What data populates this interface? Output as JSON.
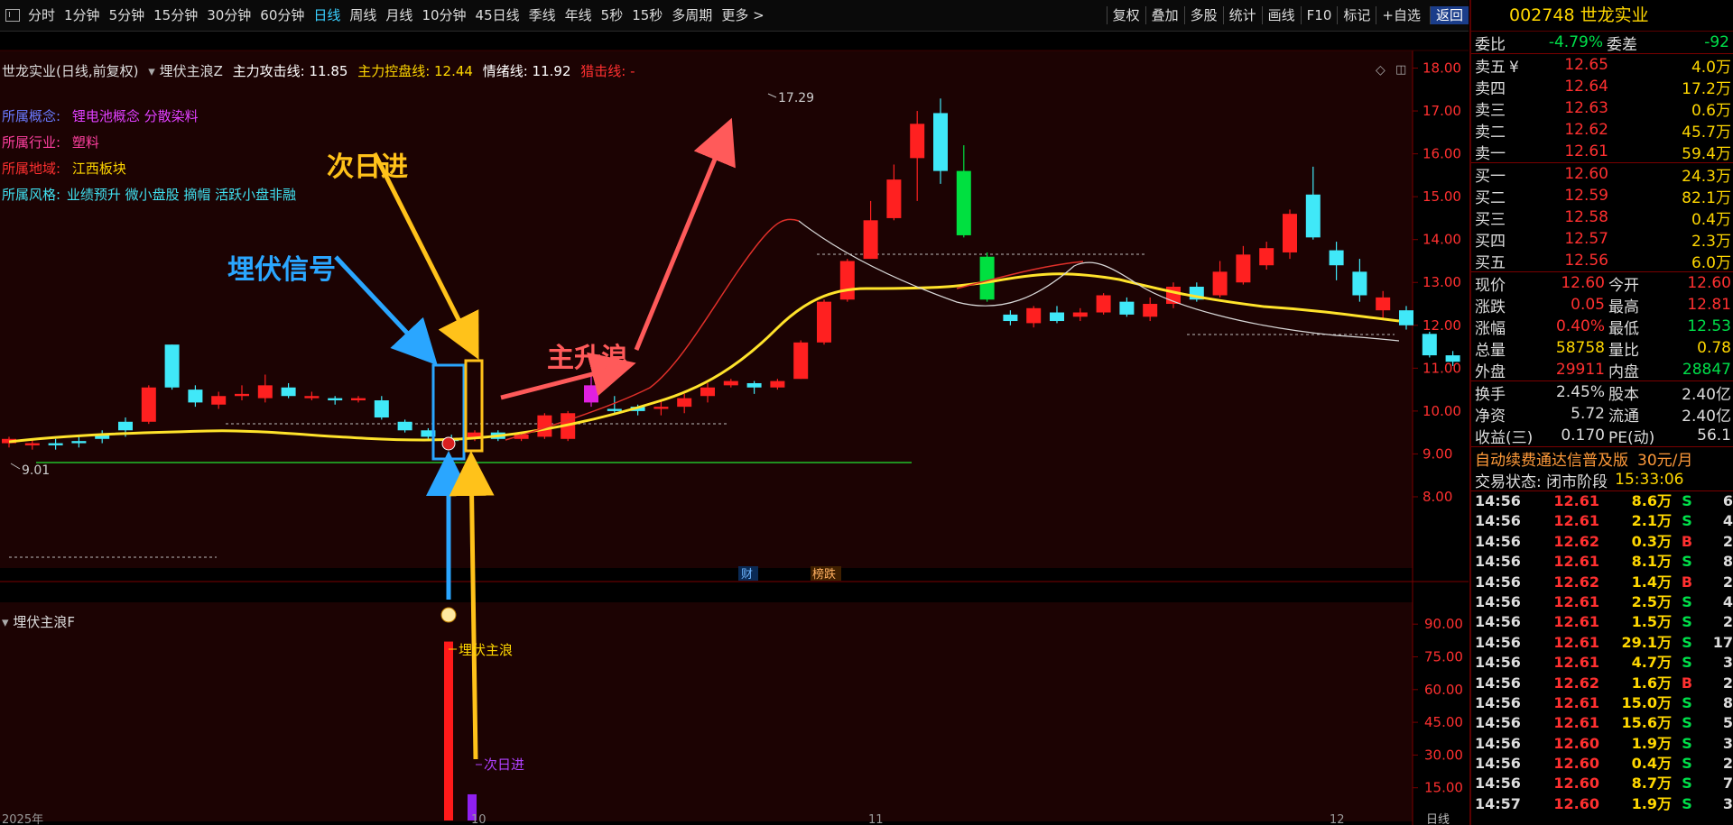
{
  "toolbar": {
    "periods": [
      "分时",
      "1分钟",
      "5分钟",
      "15分钟",
      "30分钟",
      "60分钟",
      "日线",
      "周线",
      "月线",
      "10分钟",
      "45日线",
      "季线",
      "年线",
      "5秒",
      "15秒",
      "多周期",
      "更多 >"
    ],
    "active_period": "日线",
    "right_buttons": [
      "复权",
      "叠加",
      "多股",
      "统计",
      "画线",
      "F10",
      "标记",
      "+自选",
      "返回"
    ]
  },
  "chart": {
    "header": {
      "stock_name": "世龙实业(日线,前复权)",
      "indicator_name": "埋伏主浪Z",
      "attack_label": "主力攻击线: 11.85",
      "control_label": "主力控盘线: 12.44",
      "mood_label": "情绪线: 11.92",
      "kill_label": "猎击线: -"
    },
    "concepts": [
      {
        "label": "所属概念:",
        "value": "锂电池概念 分散染料"
      },
      {
        "label": "所属行业:",
        "value": "塑料"
      },
      {
        "label": "所属地域:",
        "value": "江西板块"
      },
      {
        "label": "所属风格:",
        "value": "业绩预升 微小盘股 摘帽 活跃小盘非融"
      }
    ],
    "annotations": {
      "ambush_signal": "埋伏信号",
      "next_day_in": "次日进",
      "main_wave": "主升浪"
    },
    "high_mark": "17.29",
    "low_mark": "9.01",
    "price_axis": [
      "18.00",
      "17.00",
      "16.00",
      "15.00",
      "14.00",
      "13.00",
      "12.00",
      "11.00",
      "10.00",
      "9.00",
      "8.00"
    ],
    "event_markers": [
      "财",
      "榜跌"
    ],
    "sub_indicator": {
      "title": "埋伏主浪F",
      "axis": [
        "90.00",
        "75.00",
        "60.00",
        "45.00",
        "30.00",
        "15.00"
      ],
      "label_main": "埋伏主浪",
      "label_next": "次日进"
    },
    "date_labels": [
      "2025年",
      "10",
      "11",
      "12"
    ],
    "period_tab": "日线"
  },
  "chart_data": {
    "type": "candlestick",
    "ylim": [
      7.6,
      18.2
    ],
    "candles": [
      [
        9.35,
        9.25,
        9.4,
        9.15,
        "up"
      ],
      [
        9.25,
        9.2,
        9.35,
        9.1,
        "up"
      ],
      [
        9.2,
        9.25,
        9.35,
        9.1,
        "down"
      ],
      [
        9.25,
        9.3,
        9.4,
        9.15,
        "down"
      ],
      [
        9.35,
        9.45,
        9.55,
        9.25,
        "down"
      ],
      [
        9.55,
        9.75,
        9.85,
        9.4,
        "down"
      ],
      [
        9.75,
        10.55,
        10.6,
        9.7,
        "up"
      ],
      [
        10.55,
        11.55,
        11.55,
        10.5,
        "down"
      ],
      [
        10.5,
        10.2,
        10.6,
        10.1,
        "down"
      ],
      [
        10.15,
        10.35,
        10.45,
        10.05,
        "up"
      ],
      [
        10.35,
        10.4,
        10.6,
        10.25,
        "up"
      ],
      [
        10.3,
        10.6,
        10.85,
        10.2,
        "up"
      ],
      [
        10.55,
        10.35,
        10.65,
        10.3,
        "down"
      ],
      [
        10.35,
        10.3,
        10.45,
        10.25,
        "up"
      ],
      [
        10.3,
        10.25,
        10.35,
        10.15,
        "down"
      ],
      [
        10.3,
        10.25,
        10.35,
        10.2,
        "up"
      ],
      [
        10.25,
        9.85,
        10.35,
        9.8,
        "down"
      ],
      [
        9.75,
        9.55,
        9.8,
        9.5,
        "down"
      ],
      [
        9.55,
        9.4,
        9.6,
        9.3,
        "down"
      ],
      [
        9.35,
        9.3,
        9.45,
        9.2,
        "down"
      ],
      [
        9.35,
        9.5,
        9.55,
        9.3,
        "up"
      ],
      [
        9.5,
        9.35,
        9.55,
        9.3,
        "down"
      ],
      [
        9.35,
        9.45,
        9.5,
        9.3,
        "up"
      ],
      [
        9.4,
        9.9,
        9.95,
        9.35,
        "up"
      ],
      [
        9.35,
        9.95,
        10.0,
        9.3,
        "up"
      ],
      [
        10.2,
        10.6,
        10.85,
        10.1,
        "magenta"
      ],
      [
        10.0,
        10.05,
        10.35,
        9.95,
        "down"
      ],
      [
        10.0,
        10.1,
        10.15,
        9.9,
        "down"
      ],
      [
        10.05,
        10.1,
        10.25,
        9.9,
        "up"
      ],
      [
        10.1,
        10.3,
        10.4,
        9.95,
        "up"
      ],
      [
        10.35,
        10.55,
        10.65,
        10.2,
        "up"
      ],
      [
        10.6,
        10.7,
        10.75,
        10.55,
        "up"
      ],
      [
        10.55,
        10.65,
        10.7,
        10.4,
        "down"
      ],
      [
        10.55,
        10.7,
        10.75,
        10.5,
        "up"
      ],
      [
        10.75,
        11.6,
        11.65,
        10.75,
        "up"
      ],
      [
        11.6,
        12.55,
        12.6,
        11.55,
        "up"
      ],
      [
        12.6,
        13.5,
        13.55,
        12.55,
        "up"
      ],
      [
        13.55,
        14.45,
        14.9,
        13.55,
        "up"
      ],
      [
        14.5,
        15.4,
        15.75,
        14.45,
        "up"
      ],
      [
        15.9,
        16.7,
        17.0,
        14.9,
        "up"
      ],
      [
        16.95,
        15.6,
        17.29,
        15.3,
        "down"
      ],
      [
        15.6,
        14.1,
        16.2,
        14.05,
        "green"
      ],
      [
        13.6,
        12.6,
        13.7,
        12.55,
        "green"
      ],
      [
        12.1,
        12.25,
        12.35,
        12.0,
        "down"
      ],
      [
        12.05,
        12.4,
        12.45,
        11.95,
        "up"
      ],
      [
        12.3,
        12.1,
        12.45,
        12.05,
        "down"
      ],
      [
        12.2,
        12.3,
        12.4,
        12.1,
        "up"
      ],
      [
        12.3,
        12.7,
        12.75,
        12.25,
        "up"
      ],
      [
        12.55,
        12.25,
        12.65,
        12.2,
        "down"
      ],
      [
        12.2,
        12.5,
        12.65,
        12.1,
        "up"
      ],
      [
        12.5,
        12.9,
        13.0,
        12.4,
        "up"
      ],
      [
        12.9,
        12.6,
        13.0,
        12.55,
        "down"
      ],
      [
        12.7,
        13.25,
        13.5,
        12.65,
        "up"
      ],
      [
        13.0,
        13.65,
        13.85,
        12.95,
        "up"
      ],
      [
        13.4,
        13.8,
        13.95,
        13.3,
        "up"
      ],
      [
        13.7,
        14.6,
        14.7,
        13.55,
        "up"
      ],
      [
        14.05,
        15.05,
        15.7,
        14.0,
        "down"
      ],
      [
        13.75,
        13.4,
        13.95,
        13.05,
        "down"
      ],
      [
        13.25,
        12.7,
        13.55,
        12.55,
        "down"
      ],
      [
        12.65,
        12.35,
        12.8,
        12.15,
        "up"
      ],
      [
        12.35,
        12.0,
        12.45,
        11.9,
        "down"
      ],
      [
        11.8,
        11.3,
        11.85,
        11.25,
        "down"
      ],
      [
        11.3,
        11.15,
        11.4,
        11.05,
        "down"
      ],
      [
        11.25,
        11.8,
        11.85,
        11.2,
        "up"
      ],
      [
        11.85,
        11.75,
        11.95,
        11.7,
        "down"
      ],
      [
        11.8,
        11.85,
        11.9,
        11.65,
        "up"
      ],
      [
        11.85,
        12.15,
        12.6,
        11.8,
        "up"
      ],
      [
        12.15,
        11.95,
        12.2,
        11.9,
        "down"
      ],
      [
        11.9,
        11.85,
        11.95,
        11.7,
        "down"
      ],
      [
        11.7,
        11.5,
        11.8,
        11.2,
        "down"
      ],
      [
        11.35,
        11.6,
        11.65,
        11.15,
        "up"
      ]
    ],
    "sub_bars": [
      {
        "value": 82,
        "color": "red"
      },
      {
        "value": 12,
        "color": "purple"
      }
    ]
  },
  "quote": {
    "title": "002748 世龙实业",
    "weibi": {
      "l1": "委比",
      "v1": "-4.79%",
      "l2": "委差",
      "v2": "-92"
    },
    "asks": [
      {
        "label": "卖五",
        "mark": "¥",
        "price": "12.65",
        "vol": "4.0万"
      },
      {
        "label": "卖四",
        "mark": "",
        "price": "12.64",
        "vol": "17.2万"
      },
      {
        "label": "卖三",
        "mark": "",
        "price": "12.63",
        "vol": "0.6万"
      },
      {
        "label": "卖二",
        "mark": "",
        "price": "12.62",
        "vol": "45.7万"
      },
      {
        "label": "卖一",
        "mark": "",
        "price": "12.61",
        "vol": "59.4万"
      }
    ],
    "bids": [
      {
        "label": "买一",
        "price": "12.60",
        "vol": "24.3万"
      },
      {
        "label": "买二",
        "price": "12.59",
        "vol": "82.1万"
      },
      {
        "label": "买三",
        "price": "12.58",
        "vol": "0.4万"
      },
      {
        "label": "买四",
        "price": "12.57",
        "vol": "2.3万"
      },
      {
        "label": "买五",
        "price": "12.56",
        "vol": "6.0万"
      }
    ],
    "stats": [
      {
        "l1": "现价",
        "v1": "12.60",
        "c1": "red",
        "l2": "今开",
        "v2": "12.60",
        "c2": "red"
      },
      {
        "l1": "涨跌",
        "v1": "0.05",
        "c1": "red",
        "l2": "最高",
        "v2": "12.81",
        "c2": "red"
      },
      {
        "l1": "涨幅",
        "v1": "0.40%",
        "c1": "red",
        "l2": "最低",
        "v2": "12.53",
        "c2": "green"
      },
      {
        "l1": "总量",
        "v1": "58758",
        "c1": "yellow",
        "l2": "量比",
        "v2": "0.78",
        "c2": "yellow"
      },
      {
        "l1": "外盘",
        "v1": "29911",
        "c1": "red",
        "l2": "内盘",
        "v2": "28847",
        "c2": "green"
      }
    ],
    "stats2": [
      {
        "l1": "换手",
        "v1": "2.45%",
        "l2": "股本",
        "v2": "2.40亿"
      },
      {
        "l1": "净资",
        "v1": "5.72",
        "l2": "流通",
        "v2": "2.40亿"
      },
      {
        "l1": "收益(三)",
        "v1": "0.170",
        "l2": "PE(动)",
        "v2": "56.1"
      }
    ],
    "ad_text": "自动续费通达信普及版",
    "ad_price": "30元/月",
    "status_label": "交易状态: 闭市阶段",
    "status_time": "15:33:06",
    "ticks": [
      {
        "time": "14:56",
        "price": "12.61",
        "vol": "8.6万",
        "bs": "S",
        "cnt": "6"
      },
      {
        "time": "14:56",
        "price": "12.61",
        "vol": "2.1万",
        "bs": "S",
        "cnt": "4"
      },
      {
        "time": "14:56",
        "price": "12.62",
        "vol": "0.3万",
        "bs": "B",
        "cnt": "2"
      },
      {
        "time": "14:56",
        "price": "12.61",
        "vol": "8.1万",
        "bs": "S",
        "cnt": "8"
      },
      {
        "time": "14:56",
        "price": "12.62",
        "vol": "1.4万",
        "bs": "B",
        "cnt": "2"
      },
      {
        "time": "14:56",
        "price": "12.61",
        "vol": "2.5万",
        "bs": "S",
        "cnt": "4"
      },
      {
        "time": "14:56",
        "price": "12.61",
        "vol": "1.5万",
        "bs": "S",
        "cnt": "2"
      },
      {
        "time": "14:56",
        "price": "12.61",
        "vol": "29.1万",
        "bs": "S",
        "cnt": "17"
      },
      {
        "time": "14:56",
        "price": "12.61",
        "vol": "4.7万",
        "bs": "S",
        "cnt": "3"
      },
      {
        "time": "14:56",
        "price": "12.62",
        "vol": "1.6万",
        "bs": "B",
        "cnt": "2"
      },
      {
        "time": "14:56",
        "price": "12.61",
        "vol": "15.0万",
        "bs": "S",
        "cnt": "8"
      },
      {
        "time": "14:56",
        "price": "12.61",
        "vol": "15.6万",
        "bs": "S",
        "cnt": "5"
      },
      {
        "time": "14:56",
        "price": "12.60",
        "vol": "1.9万",
        "bs": "S",
        "cnt": "3"
      },
      {
        "time": "14:56",
        "price": "12.60",
        "vol": "0.4万",
        "bs": "S",
        "cnt": "2"
      },
      {
        "time": "14:56",
        "price": "12.60",
        "vol": "8.7万",
        "bs": "S",
        "cnt": "7"
      },
      {
        "time": "14:57",
        "price": "12.60",
        "vol": "1.9万",
        "bs": "S",
        "cnt": "3"
      }
    ]
  }
}
